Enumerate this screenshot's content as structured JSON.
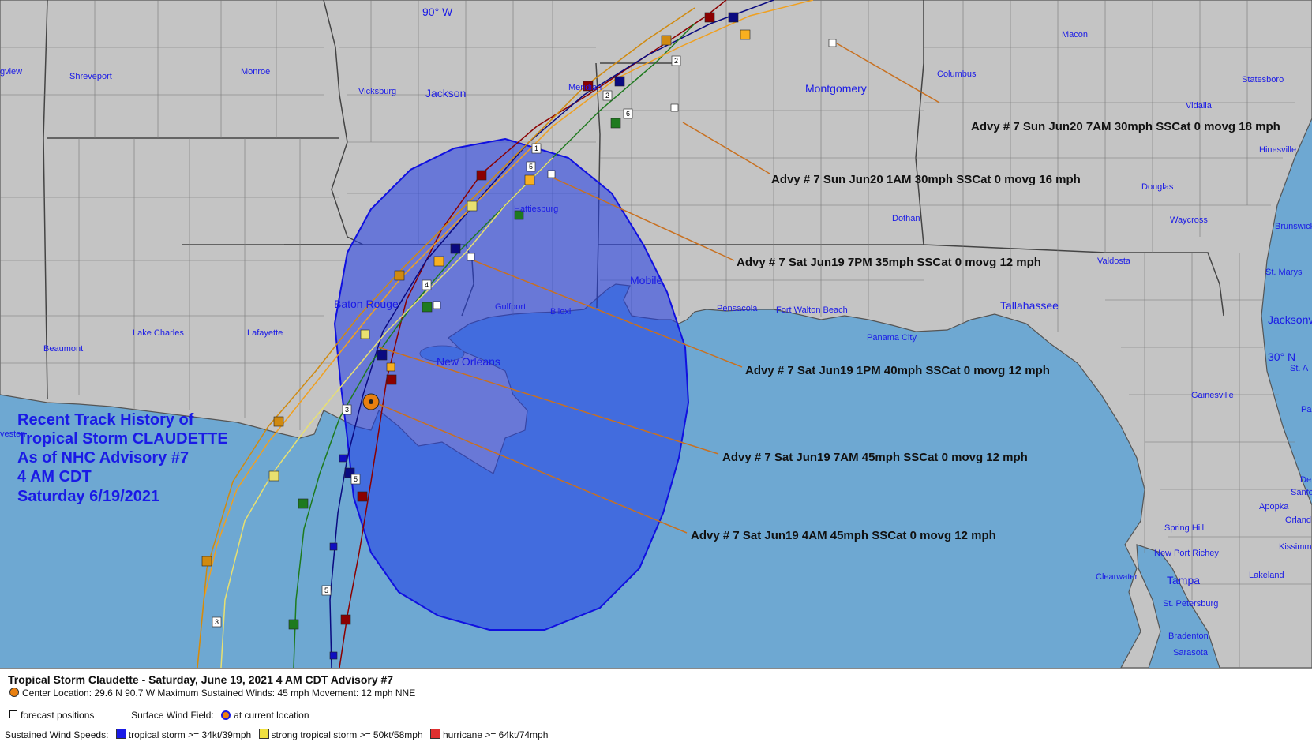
{
  "map": {
    "colors": {
      "water": "#6ea8d2",
      "land": "#c4c4c4",
      "border": "#555555",
      "wind_field": "#1f3be8",
      "tracks": [
        "#8b0000",
        "#0a0a80",
        "#1e7a1e",
        "#f0a020",
        "#d08a10",
        "#e0d060"
      ]
    },
    "lat_lon_labels": {
      "lon_90": "90° W",
      "lat_30": "30° N"
    },
    "cities": [
      {
        "name": "Shreveport",
        "size": "small"
      },
      {
        "name": "Monroe",
        "size": "small"
      },
      {
        "name": "Vicksburg",
        "size": "small"
      },
      {
        "name": "Jackson",
        "size": "big"
      },
      {
        "name": "Meridian",
        "size": "small"
      },
      {
        "name": "Montgomery",
        "size": "big"
      },
      {
        "name": "Columbus",
        "size": "small"
      },
      {
        "name": "Macon",
        "size": "small"
      },
      {
        "name": "Statesboro",
        "size": "small"
      },
      {
        "name": "Vidalia",
        "size": "small"
      },
      {
        "name": "Hinesville",
        "size": "small"
      },
      {
        "name": "Douglas",
        "size": "small"
      },
      {
        "name": "Waycross",
        "size": "small"
      },
      {
        "name": "Brunswick",
        "size": "small"
      },
      {
        "name": "Dothan",
        "size": "small"
      },
      {
        "name": "Valdosta",
        "size": "small"
      },
      {
        "name": "St. Marys",
        "size": "small"
      },
      {
        "name": "Hattiesburg",
        "size": "small"
      },
      {
        "name": "Mobile",
        "size": "big"
      },
      {
        "name": "Pensacola",
        "size": "small"
      },
      {
        "name": "Fort Walton Beach",
        "size": "small"
      },
      {
        "name": "Panama City",
        "size": "small"
      },
      {
        "name": "Tallahassee",
        "size": "big"
      },
      {
        "name": "Jacksonville",
        "size": "big"
      },
      {
        "name": "Gulfport",
        "size": "small"
      },
      {
        "name": "Biloxi",
        "size": "small"
      },
      {
        "name": "Baton Rouge",
        "size": "big"
      },
      {
        "name": "New Orleans",
        "size": "big"
      },
      {
        "name": "Lake Charles",
        "size": "small"
      },
      {
        "name": "Lafayette",
        "size": "small"
      },
      {
        "name": "Beaumont",
        "size": "small"
      },
      {
        "name": "Gainesville",
        "size": "small"
      },
      {
        "name": "Spring Hill",
        "size": "small"
      },
      {
        "name": "New Port Richey",
        "size": "small"
      },
      {
        "name": "Clearwater",
        "size": "small"
      },
      {
        "name": "Tampa",
        "size": "big"
      },
      {
        "name": "Lakeland",
        "size": "small"
      },
      {
        "name": "St. Petersburg",
        "size": "small"
      },
      {
        "name": "Bradenton",
        "size": "small"
      },
      {
        "name": "Sarasota",
        "size": "small"
      },
      {
        "name": "Kissimm",
        "size": "small"
      },
      {
        "name": "Orland",
        "size": "small"
      },
      {
        "name": "Apopka",
        "size": "small"
      },
      {
        "name": "Sanfo",
        "size": "small"
      },
      {
        "name": "De",
        "size": "small"
      },
      {
        "name": "St. A",
        "size": "small"
      },
      {
        "name": "Pa",
        "size": "small"
      },
      {
        "name": "gview",
        "size": "small"
      },
      {
        "name": "veston",
        "size": "small"
      }
    ],
    "advisory_labels": [
      "Advy # 7 Sun Jun20 7AM  30mph SSCat 0 movg 18 mph",
      "Advy # 7 Sun Jun20 1AM  30mph SSCat 0 movg 16 mph",
      "Advy # 7 Sat Jun19 7PM  35mph SSCat 0 movg 12 mph",
      "Advy # 7 Sat Jun19 1PM  40mph SSCat 0 movg 12 mph",
      "Advy # 7 Sat Jun19 7AM  45mph SSCat 0 movg 12 mph",
      "Advy # 7 Sat Jun19 4AM  45mph SSCat 0 movg 12 mph"
    ],
    "forecast_day_labels": [
      "1",
      "2",
      "3",
      "4",
      "5",
      "6",
      "2",
      "3",
      "5",
      "5",
      "3"
    ],
    "history_title": [
      "Recent Track History of",
      "Tropical Storm CLAUDETTE",
      "As of NHC Advisory #7",
      "4 AM CDT",
      "Saturday 6/19/2021"
    ]
  },
  "legend": {
    "title": "Tropical Storm Claudette  -  Saturday, June 19, 2021  4 AM CDT   Advisory #7",
    "center_line": "Center Location: 29.6 N  90.7 W   Maximum Sustained Winds: 45 mph  Movement: 12 mph NNE",
    "forecast_positions": "forecast positions",
    "surface_wind_field": "Surface Wind Field:",
    "at_current_location": "at current location",
    "sustained_label": "Sustained Wind Speeds:",
    "ts": "tropical storm >= 34kt/39mph",
    "sts": "strong tropical storm >= 50kt/58mph",
    "hu": "hurricane >= 64kt/74mph",
    "colors": {
      "ts": "#1a1ae6",
      "sts": "#f0e040",
      "hu": "#e03030"
    }
  }
}
